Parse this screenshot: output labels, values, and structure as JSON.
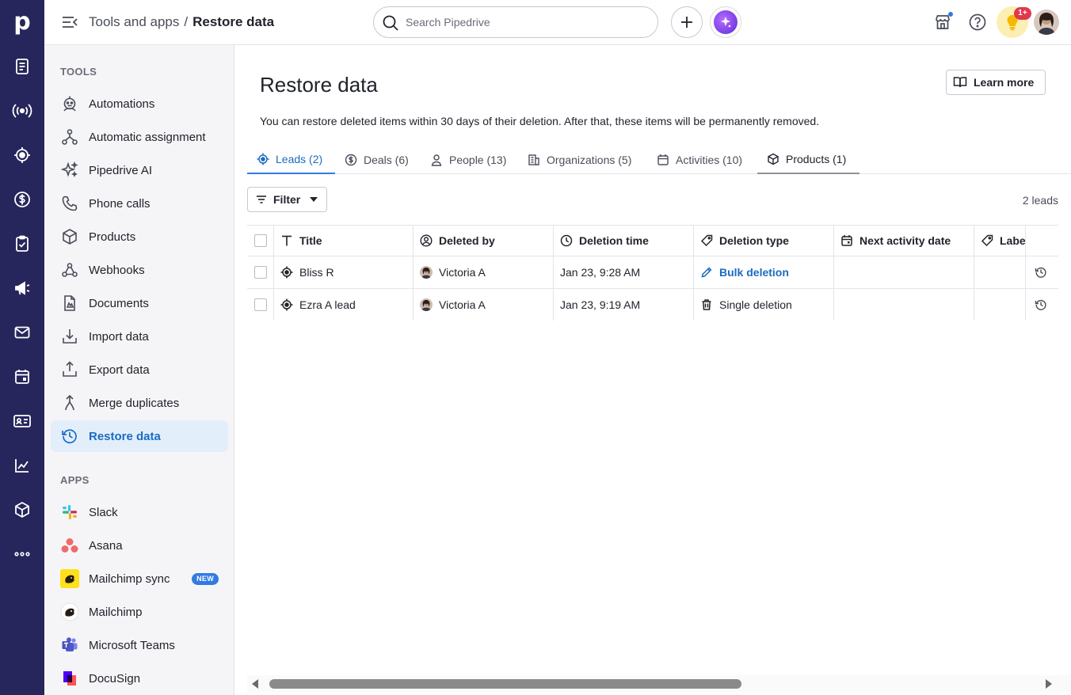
{
  "rail": {
    "logo": "p",
    "items": [
      "leads-inbox",
      "campaigns-broadcast",
      "leads",
      "deals",
      "tasks",
      "marketing",
      "mail",
      "calendar",
      "contacts",
      "insights",
      "products",
      "more"
    ]
  },
  "header": {
    "breadcrumb_parent": "Tools and apps",
    "breadcrumb_sep": "/",
    "breadcrumb_current": "Restore data",
    "search_placeholder": "Search Pipedrive",
    "notification_badge": "1+"
  },
  "sidebar": {
    "tools_heading": "TOOLS",
    "apps_heading": "APPS",
    "tools": [
      {
        "label": "Automations",
        "icon": "robot-icon"
      },
      {
        "label": "Automatic assignment",
        "icon": "assignment-icon"
      },
      {
        "label": "Pipedrive AI",
        "icon": "sparkles-icon"
      },
      {
        "label": "Phone calls",
        "icon": "phone-icon"
      },
      {
        "label": "Products",
        "icon": "box-icon"
      },
      {
        "label": "Webhooks",
        "icon": "webhook-icon"
      },
      {
        "label": "Documents",
        "icon": "document-icon"
      },
      {
        "label": "Import data",
        "icon": "import-icon"
      },
      {
        "label": "Export data",
        "icon": "export-icon"
      },
      {
        "label": "Merge duplicates",
        "icon": "merge-icon"
      },
      {
        "label": "Restore data",
        "icon": "restore-icon"
      }
    ],
    "apps": [
      {
        "label": "Slack",
        "icon": "slack-icon"
      },
      {
        "label": "Asana",
        "icon": "asana-icon"
      },
      {
        "label": "Mailchimp sync",
        "icon": "mailchimp-icon",
        "badge": "NEW"
      },
      {
        "label": "Mailchimp",
        "icon": "mailchimp-icon"
      },
      {
        "label": "Microsoft Teams",
        "icon": "teams-icon"
      },
      {
        "label": "DocuSign",
        "icon": "docusign-icon"
      }
    ]
  },
  "main": {
    "title": "Restore data",
    "learn_more": "Learn more",
    "description": "You can restore deleted items within 30 days of their deletion. After that, these items will be permanently removed.",
    "tabs": [
      {
        "label": "Leads (2)",
        "icon": "target-icon"
      },
      {
        "label": "Deals (6)",
        "icon": "dollar-icon"
      },
      {
        "label": "People (13)",
        "icon": "person-icon"
      },
      {
        "label": "Organizations (5)",
        "icon": "building-icon"
      },
      {
        "label": "Activities (10)",
        "icon": "calendar-icon"
      },
      {
        "label": "Products (1)",
        "icon": "box-icon"
      }
    ],
    "filter_label": "Filter",
    "count_label": "2 leads",
    "columns": [
      "Title",
      "Deleted by",
      "Deletion time",
      "Deletion type",
      "Next activity date",
      "Labe"
    ],
    "rows": [
      {
        "title": "Bliss R",
        "deleted_by": "Victoria A",
        "time": "Jan 23, 9:28 AM",
        "type": "Bulk deletion",
        "next_activity": "",
        "label": ""
      },
      {
        "title": "Ezra A lead",
        "deleted_by": "Victoria A",
        "time": "Jan 23, 9:19 AM",
        "type": "Single deletion",
        "next_activity": "",
        "label": ""
      }
    ]
  },
  "colors": {
    "rail": "#26265c",
    "accent": "#317ae2",
    "link": "#1a6cc1",
    "badge": "#e0384c"
  }
}
